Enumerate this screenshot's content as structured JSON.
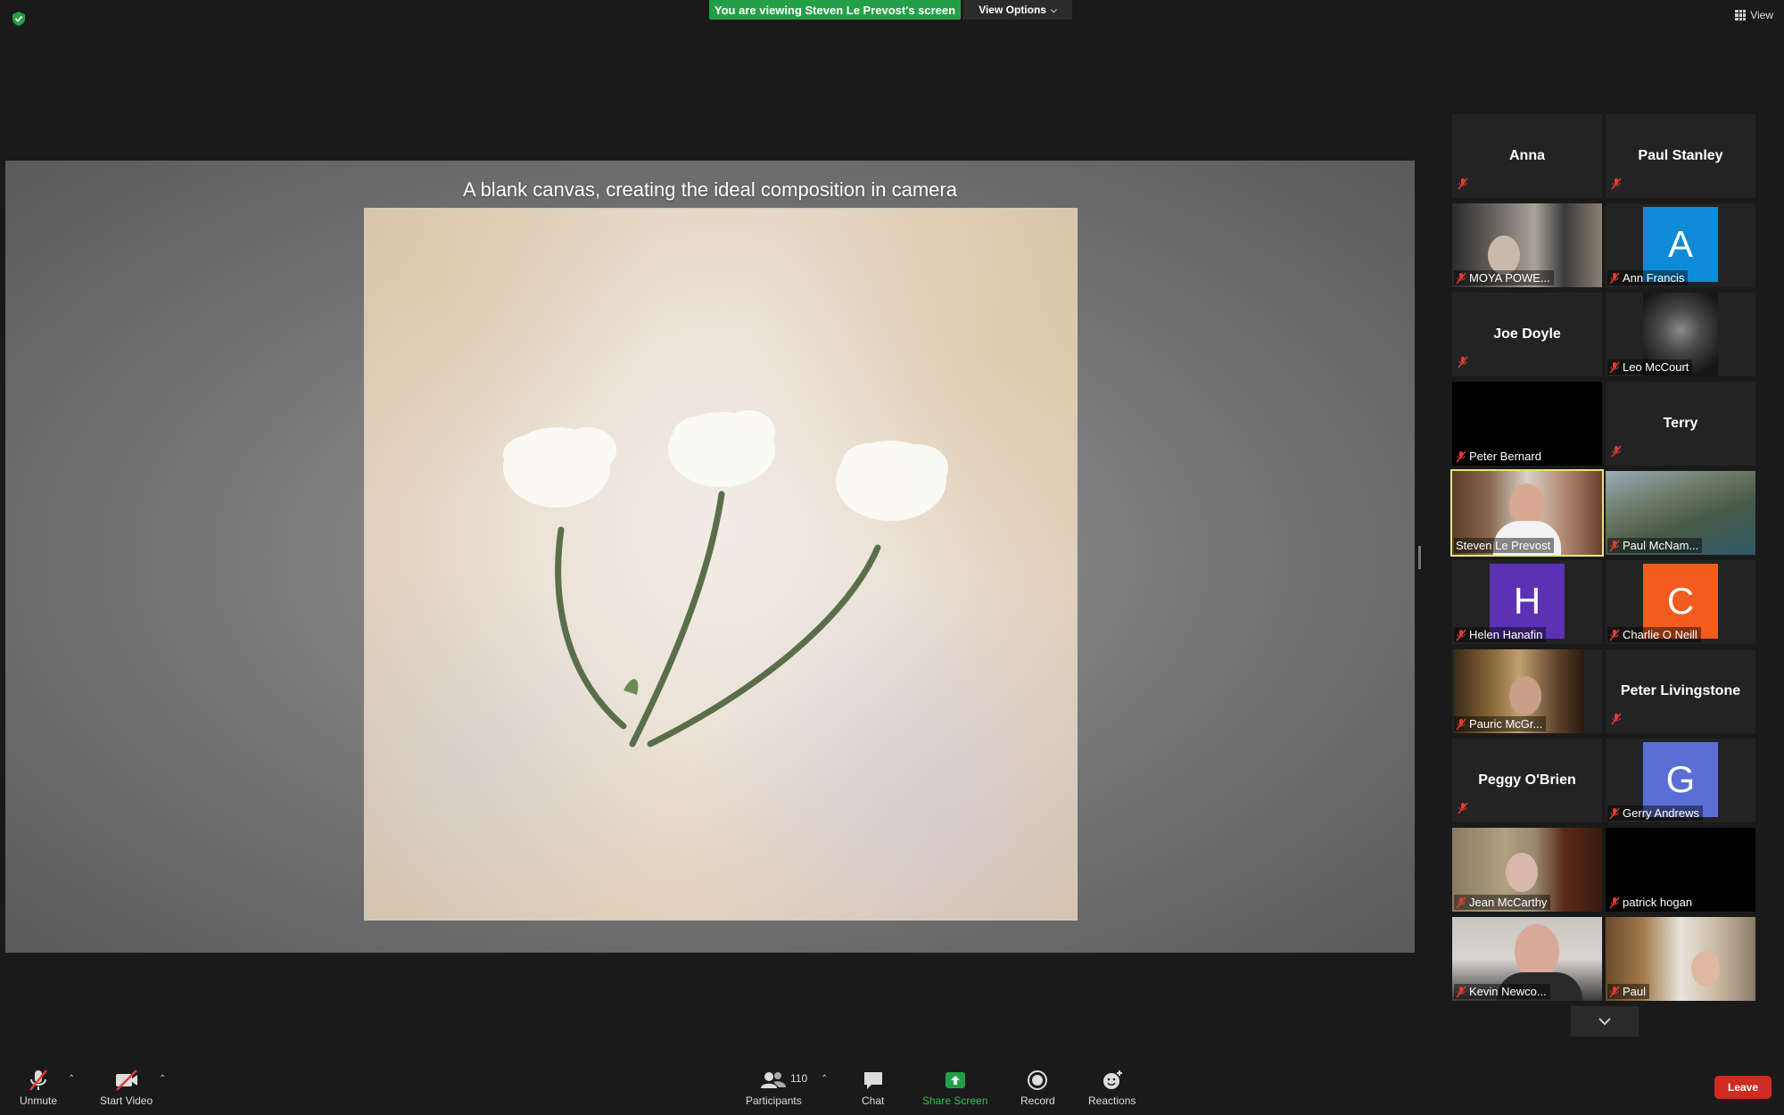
{
  "top": {
    "banner": "You are viewing Steven Le Prevost's screen",
    "view_options": "View Options",
    "view": "View"
  },
  "shared_screen": {
    "title": "A blank canvas, creating the ideal composition in camera"
  },
  "participants": [
    {
      "name": "Anna",
      "kind": "name"
    },
    {
      "name": "Paul Stanley",
      "kind": "name"
    },
    {
      "name": "MOYA POWE...",
      "kind": "video"
    },
    {
      "name": "Ann Francis",
      "kind": "avatar",
      "letter": "A",
      "color": "#0e8bd6"
    },
    {
      "name": "Joe Doyle",
      "kind": "name"
    },
    {
      "name": "Leo McCourt",
      "kind": "video"
    },
    {
      "name": "Peter Bernard",
      "kind": "black"
    },
    {
      "name": "Terry",
      "kind": "name"
    },
    {
      "name": "Steven Le Prevost",
      "kind": "video",
      "active": true
    },
    {
      "name": "Paul McNam...",
      "kind": "video"
    },
    {
      "name": "Helen Hanafin",
      "kind": "avatar",
      "letter": "H",
      "color": "#5b32b4"
    },
    {
      "name": "Charlie O Neill",
      "kind": "avatar",
      "letter": "C",
      "color": "#f25c1e"
    },
    {
      "name": "Pauric McGr...",
      "kind": "video"
    },
    {
      "name": "Peter Livingstone",
      "kind": "name"
    },
    {
      "name": "Peggy O'Brien",
      "kind": "name"
    },
    {
      "name": "Gerry Andrews",
      "kind": "avatar",
      "letter": "G",
      "color": "#5a6fd6"
    },
    {
      "name": "Jean McCarthy",
      "kind": "video"
    },
    {
      "name": "patrick hogan",
      "kind": "black"
    },
    {
      "name": "Kevin Newco...",
      "kind": "video"
    },
    {
      "name": "Paul",
      "kind": "video"
    }
  ],
  "toolbar": {
    "unmute": "Unmute",
    "start_video": "Start Video",
    "participants": "Participants",
    "participant_count": "110",
    "chat": "Chat",
    "share_screen": "Share Screen",
    "record": "Record",
    "reactions": "Reactions",
    "leave": "Leave"
  },
  "colors": {
    "share_green": "#23a047",
    "active_speaker": "#e2e77d",
    "leave_red": "#d02a22"
  }
}
